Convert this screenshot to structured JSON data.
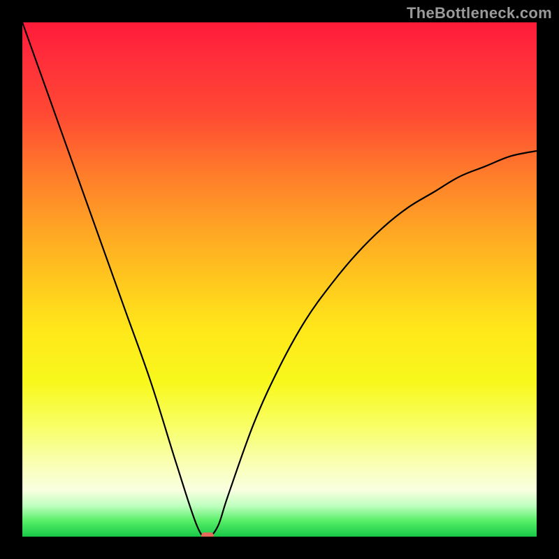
{
  "watermark": "TheBottleneck.com",
  "chart_data": {
    "type": "line",
    "title": "",
    "xlabel": "",
    "ylabel": "",
    "xlim": [
      0,
      100
    ],
    "ylim": [
      0,
      100
    ],
    "grid": false,
    "legend": false,
    "background": {
      "type": "vertical-gradient",
      "stops": [
        {
          "pct": 0,
          "color": "#ff1a3a"
        },
        {
          "pct": 50,
          "color": "#ffe81a"
        },
        {
          "pct": 95,
          "color": "#55ee66"
        },
        {
          "pct": 100,
          "color": "#18c847"
        }
      ],
      "meaning": "red=high bottleneck, green=low bottleneck"
    },
    "series": [
      {
        "name": "bottleneck-curve",
        "x": [
          0,
          5,
          10,
          15,
          20,
          25,
          30,
          34,
          36,
          38,
          40,
          45,
          50,
          55,
          60,
          65,
          70,
          75,
          80,
          85,
          90,
          95,
          100
        ],
        "y": [
          100,
          86,
          72,
          58,
          44,
          30,
          14,
          2,
          0,
          2,
          8,
          22,
          33,
          42,
          49,
          55,
          60,
          64,
          67,
          70,
          72,
          74,
          75
        ]
      }
    ],
    "annotations": [
      {
        "name": "optimal-marker",
        "x": 36,
        "y": 0,
        "color": "#e46a5a",
        "shape": "rounded-rect"
      }
    ],
    "minimum": {
      "x": 36,
      "y": 0
    }
  }
}
